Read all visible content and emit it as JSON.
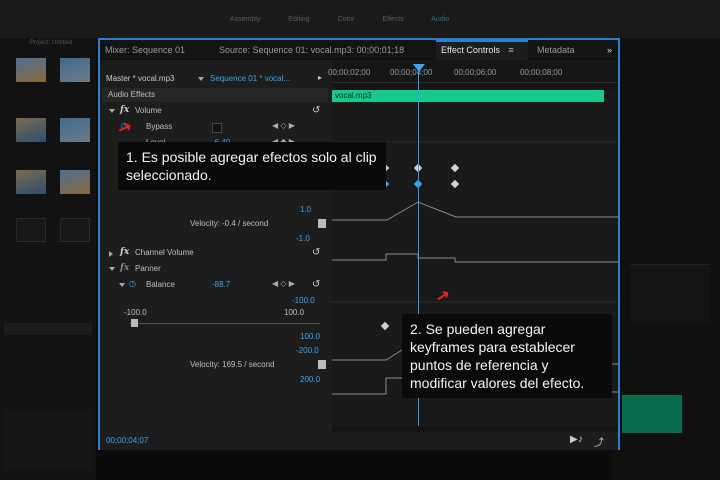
{
  "tabs": {
    "mixer": "Mixer: Sequence 01",
    "source": "Source: Sequence 01: vocal.mp3: 00;00;01;18",
    "effect_controls": "Effect Controls",
    "metadata": "Metadata",
    "overflow": "»",
    "menu": "≡"
  },
  "header": {
    "master": "Master * vocal.mp3",
    "sequence": "Sequence 01 * vocal...",
    "play_arrow": "▸"
  },
  "timeline": {
    "t1": "00;00;02;00",
    "t2": "00;00;04;00",
    "t3": "00;00;06;00",
    "t4": "00;00;08;00",
    "clip_name": "vocal.mp3"
  },
  "audio_effects_label": "Audio Effects",
  "volume": {
    "fx": "fx",
    "label": "Volume",
    "bypass": "Bypass",
    "level_label": "Level",
    "level_value": "-6.40",
    "level_max": "1.0",
    "velocity": "Velocity: -0.4 / second",
    "level_min": "-1.0"
  },
  "channel_volume": {
    "fx": "fx",
    "label": "Channel Volume"
  },
  "panner": {
    "fx": "fx",
    "label": "Panner",
    "balance_label": "Balance",
    "balance_value": "-88.7",
    "range_top": "-100.0",
    "range_left": "-100.0",
    "range_right": "100.0",
    "graph_top": "100.0",
    "graph_bottom": "-200.0",
    "velocity": "Velocity: 169.5 / second",
    "vel_max": "200.0"
  },
  "footer": {
    "timecode": "00;00;04;07"
  },
  "tips": {
    "tip1": "1. Es posible agregar efectos solo al clip seleccionado.",
    "tip2": "2. Se pueden agregar keyframes para establecer puntos de referencia y modificar valores del efecto."
  },
  "topnav": [
    "Assembly",
    "Editing",
    "Color",
    "Effects",
    "Audio"
  ],
  "left_panel": {
    "tab_label": "Project: Untitled"
  },
  "colors": {
    "accent": "#2d7fd0",
    "clip": "#16c98c",
    "keyframe_blue": "#3aa6ee",
    "arrow": "#e0261f"
  }
}
